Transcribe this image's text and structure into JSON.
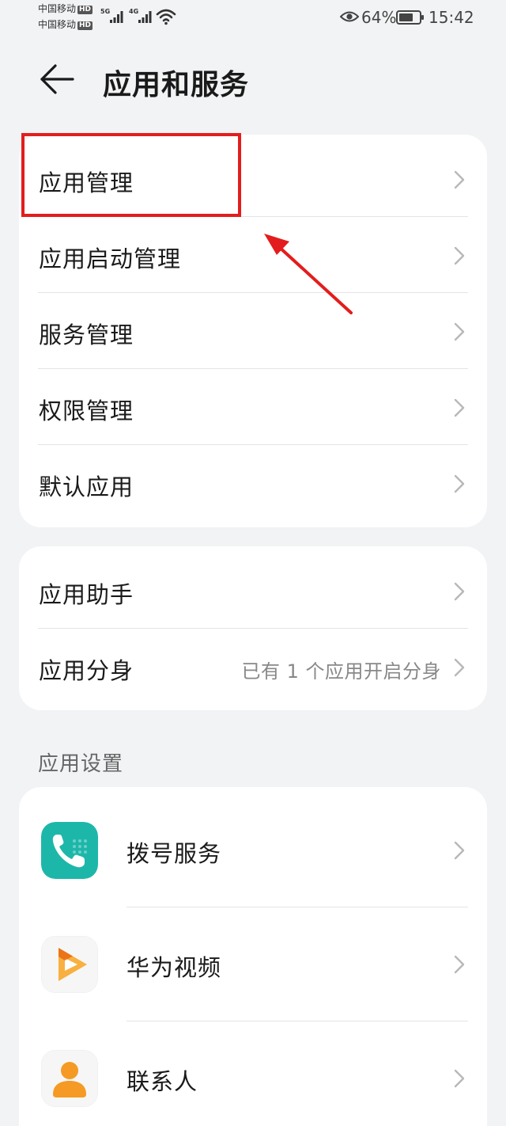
{
  "status_bar": {
    "carrier1": "中国移动",
    "carrier2": "中国移动",
    "hd_badge": "HD",
    "net1": "5G",
    "net2": "4G",
    "battery_percent": "64%",
    "time": "15:42"
  },
  "header": {
    "title": "应用和服务"
  },
  "group1": [
    {
      "label": "应用管理"
    },
    {
      "label": "应用启动管理"
    },
    {
      "label": "服务管理"
    },
    {
      "label": "权限管理"
    },
    {
      "label": "默认应用"
    }
  ],
  "group2": [
    {
      "label": "应用助手",
      "value": ""
    },
    {
      "label": "应用分身",
      "value": "已有 1 个应用开启分身"
    }
  ],
  "app_settings": {
    "section_title": "应用设置",
    "items": [
      {
        "label": "拨号服务",
        "icon": "phone-icon",
        "color": "#1db7aa"
      },
      {
        "label": "华为视频",
        "icon": "play-icon",
        "color": "#f08a14"
      },
      {
        "label": "联系人",
        "icon": "person-icon",
        "color": "#f59a24"
      }
    ]
  },
  "colors": {
    "background": "#f1f3f5",
    "card": "#ffffff",
    "annotation": "#e31d1d"
  }
}
